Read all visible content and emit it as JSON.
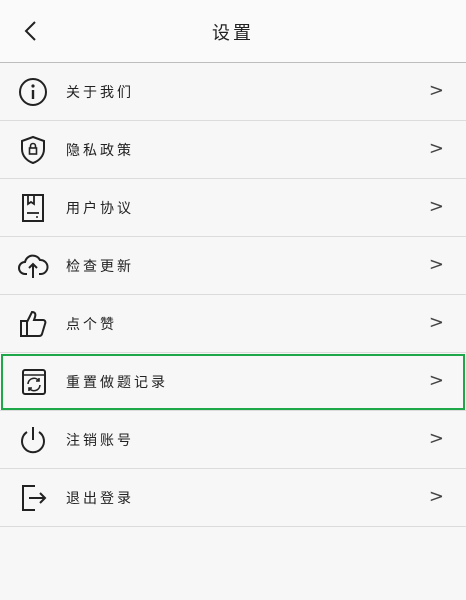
{
  "header": {
    "title": "设置"
  },
  "items": [
    {
      "icon": "info-icon",
      "label": "关于我们",
      "chevron": ">"
    },
    {
      "icon": "shield-icon",
      "label": "隐私政策",
      "chevron": ">"
    },
    {
      "icon": "document-icon",
      "label": "用户协议",
      "chevron": ">"
    },
    {
      "icon": "cloud-upload-icon",
      "label": "检查更新",
      "chevron": ">"
    },
    {
      "icon": "thumbs-up-icon",
      "label": "点个赞",
      "chevron": ">"
    },
    {
      "icon": "reset-icon",
      "label": "重置做题记录",
      "chevron": ">"
    },
    {
      "icon": "power-icon",
      "label": "注销账号",
      "chevron": ">"
    },
    {
      "icon": "logout-icon",
      "label": "退出登录",
      "chevron": ">"
    }
  ],
  "highlight_color": "#1fa84a"
}
